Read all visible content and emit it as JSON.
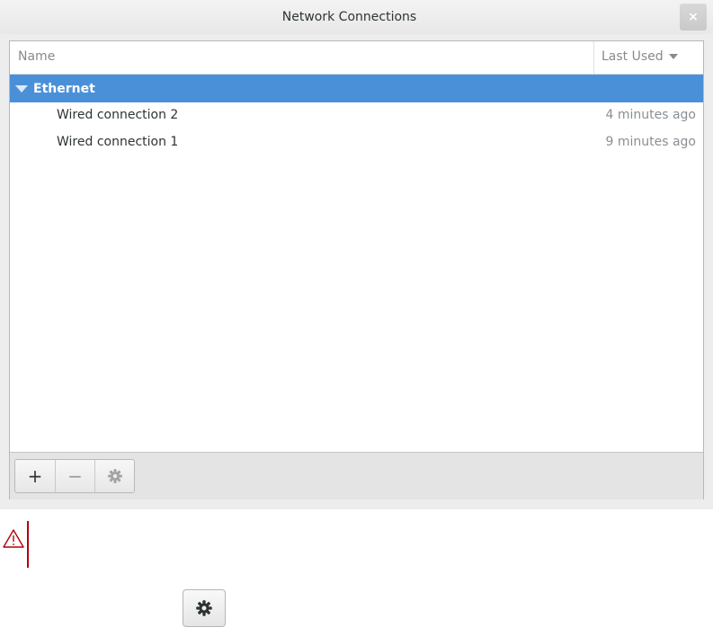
{
  "window": {
    "title": "Network Connections",
    "close_label": "×"
  },
  "list": {
    "columns": {
      "name": "Name",
      "last_used": "Last Used"
    },
    "group": {
      "label": "Ethernet"
    },
    "connections": [
      {
        "name": "Wired connection 2",
        "last_used": "4 minutes ago"
      },
      {
        "name": "Wired connection 1",
        "last_used": "9 minutes ago"
      }
    ]
  },
  "toolbar": {
    "add_label": "+",
    "remove_label": "−",
    "icons": {
      "settings": "gear-icon"
    }
  },
  "colors": {
    "selection": "#4a90d9",
    "warning": "#b3000a"
  }
}
